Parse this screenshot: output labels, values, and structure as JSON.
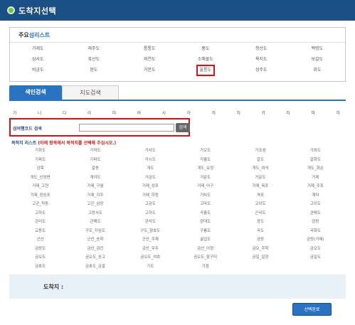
{
  "window": {
    "title": "도착지선택"
  },
  "islands": {
    "heading_prefix": "주요",
    "heading_highlight": "섬리스트",
    "items": [
      "거제도",
      "제주도",
      "통통도",
      "홍도",
      "청산도",
      "백령도",
      "삼사도",
      "흑산도",
      "외연도",
      "소매물도",
      "욕지도",
      "보길도",
      "비금도",
      "완도",
      "거문도",
      "울릉도",
      "성주도",
      "위도"
    ]
  },
  "tabs": {
    "index": "색인검색",
    "map": "지도검색"
  },
  "consonants": [
    "가",
    "나",
    "다",
    "라",
    "마",
    "바",
    "사",
    "아",
    "자",
    "차",
    "카",
    "타",
    "파",
    "하"
  ],
  "code_search": {
    "label": "섬여행코드 검색",
    "placeholder": "",
    "button": "검색"
  },
  "dest_list": {
    "title": "목적지 리스트",
    "hint": "(아래 항목에서 목적지를 선택해 주십시오.)"
  },
  "destinations": [
    "가화도",
    "가덕도",
    "가사도",
    "가오도",
    "가조섬",
    "가좌도",
    "가파도",
    "가파도",
    "각시도",
    "각흘도",
    "갈도",
    "갈화도",
    "감목",
    "갈동",
    "개도",
    "개도_요정",
    "개도_여석",
    "개도_화순",
    "개도_신양면",
    "개야도",
    "거금도",
    "거문도",
    "거문도",
    "거제",
    "거제_고현",
    "거제_구월",
    "거제_성포",
    "거제_어구",
    "거제_옥포",
    "거제_주포",
    "거제_장승포",
    "거제_지주",
    "거제_하청",
    "거차도",
    "격포",
    "계마",
    "고군_적동",
    "고군_삼장",
    "고금도",
    "고마도",
    "고이도",
    "고이도",
    "고하도",
    "고랑사도",
    "고하도",
    "곡흘도",
    "곤리도",
    "관매도",
    "관리도",
    "관매도",
    "관사도",
    "광대도",
    "광도",
    "광랑",
    "교동도",
    "구도_지심도",
    "구도_향호도",
    "구룡도",
    "국도",
    "국화도",
    "군산",
    "군산_송학",
    "군산_주제",
    "굴업도",
    "금랑",
    "금랑(거제)",
    "금랑도",
    "금산_금진",
    "금산_무주",
    "금산_어청",
    "금오_주학",
    "금오도",
    "금오도",
    "금오도_송고",
    "금오도_여호",
    "금오도_함구미",
    "금일_일정",
    "금일도",
    "금호도",
    "금호도_금흥",
    "기도",
    "기점"
  ],
  "arrival": {
    "label": "도착지 :"
  },
  "confirm_button": "선택완료"
}
